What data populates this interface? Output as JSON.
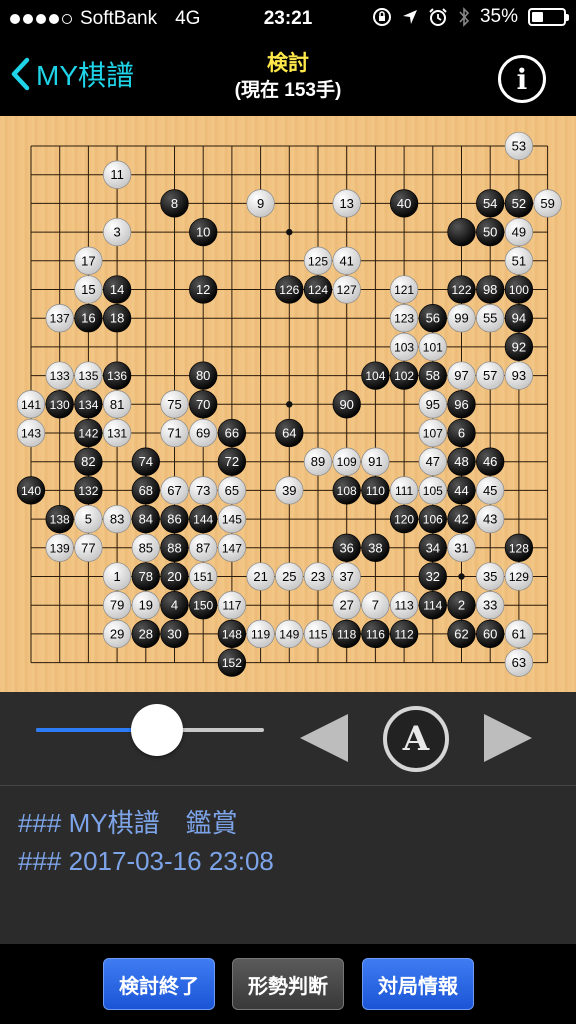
{
  "status": {
    "carrier": "SoftBank",
    "network": "4G",
    "time": "23:21",
    "battery_text": "35%",
    "battery_level": 0.35,
    "signal_bars": 4,
    "icons": [
      "rotation-lock-icon",
      "location-icon",
      "alarm-icon",
      "bluetooth-icon",
      "battery-icon"
    ]
  },
  "nav": {
    "back_label": "MY棋譜",
    "title": "検討",
    "subtitle": "(現在 153手)",
    "info_label": "i"
  },
  "colors": {
    "accent_cyan": "#1fd3e8",
    "title_yellow": "#ffe94a",
    "slider_blue": "#2b7cf6",
    "comment_text": "#7da4e8",
    "button_blue": "#2563e0"
  },
  "board": {
    "size": 19,
    "stones": [
      {
        "c": "w",
        "n": "53",
        "x": 17,
        "y": 0
      },
      {
        "c": "w",
        "n": "11",
        "x": 3,
        "y": 1
      },
      {
        "c": "b",
        "n": "8",
        "x": 5,
        "y": 2
      },
      {
        "c": "w",
        "n": "9",
        "x": 8,
        "y": 2
      },
      {
        "c": "w",
        "n": "13",
        "x": 11,
        "y": 2
      },
      {
        "c": "b",
        "n": "40",
        "x": 13,
        "y": 2
      },
      {
        "c": "b",
        "n": "54",
        "x": 16,
        "y": 2
      },
      {
        "c": "b",
        "n": "52",
        "x": 17,
        "y": 2
      },
      {
        "c": "w",
        "n": "59",
        "x": 18,
        "y": 2
      },
      {
        "c": "w",
        "n": "3",
        "x": 3,
        "y": 3
      },
      {
        "c": "b",
        "n": "10",
        "x": 6,
        "y": 3
      },
      {
        "c": "b",
        "n": "",
        "x": 15,
        "y": 3
      },
      {
        "c": "b",
        "n": "50",
        "x": 16,
        "y": 3
      },
      {
        "c": "w",
        "n": "49",
        "x": 17,
        "y": 3
      },
      {
        "c": "w",
        "n": "17",
        "x": 2,
        "y": 4
      },
      {
        "c": "w",
        "n": "125",
        "x": 10,
        "y": 4
      },
      {
        "c": "w",
        "n": "41",
        "x": 11,
        "y": 4
      },
      {
        "c": "w",
        "n": "51",
        "x": 17,
        "y": 4
      },
      {
        "c": "w",
        "n": "15",
        "x": 2,
        "y": 5
      },
      {
        "c": "b",
        "n": "14",
        "x": 3,
        "y": 5
      },
      {
        "c": "b",
        "n": "12",
        "x": 6,
        "y": 5
      },
      {
        "c": "b",
        "n": "126",
        "x": 9,
        "y": 5
      },
      {
        "c": "b",
        "n": "124",
        "x": 10,
        "y": 5
      },
      {
        "c": "w",
        "n": "127",
        "x": 11,
        "y": 5
      },
      {
        "c": "w",
        "n": "121",
        "x": 13,
        "y": 5
      },
      {
        "c": "b",
        "n": "122",
        "x": 15,
        "y": 5
      },
      {
        "c": "b",
        "n": "98",
        "x": 16,
        "y": 5
      },
      {
        "c": "b",
        "n": "100",
        "x": 17,
        "y": 5
      },
      {
        "c": "w",
        "n": "137",
        "x": 1,
        "y": 6
      },
      {
        "c": "b",
        "n": "16",
        "x": 2,
        "y": 6
      },
      {
        "c": "b",
        "n": "18",
        "x": 3,
        "y": 6
      },
      {
        "c": "w",
        "n": "123",
        "x": 13,
        "y": 6
      },
      {
        "c": "b",
        "n": "56",
        "x": 14,
        "y": 6
      },
      {
        "c": "w",
        "n": "99",
        "x": 15,
        "y": 6
      },
      {
        "c": "w",
        "n": "55",
        "x": 16,
        "y": 6
      },
      {
        "c": "b",
        "n": "94",
        "x": 17,
        "y": 6
      },
      {
        "c": "w",
        "n": "103",
        "x": 13,
        "y": 7
      },
      {
        "c": "w",
        "n": "101",
        "x": 14,
        "y": 7
      },
      {
        "c": "b",
        "n": "92",
        "x": 17,
        "y": 7
      },
      {
        "c": "w",
        "n": "133",
        "x": 1,
        "y": 8
      },
      {
        "c": "w",
        "n": "135",
        "x": 2,
        "y": 8
      },
      {
        "c": "b",
        "n": "136",
        "x": 3,
        "y": 8
      },
      {
        "c": "b",
        "n": "80",
        "x": 6,
        "y": 8
      },
      {
        "c": "b",
        "n": "104",
        "x": 12,
        "y": 8
      },
      {
        "c": "b",
        "n": "102",
        "x": 13,
        "y": 8
      },
      {
        "c": "b",
        "n": "58",
        "x": 14,
        "y": 8
      },
      {
        "c": "w",
        "n": "97",
        "x": 15,
        "y": 8
      },
      {
        "c": "w",
        "n": "57",
        "x": 16,
        "y": 8
      },
      {
        "c": "w",
        "n": "93",
        "x": 17,
        "y": 8
      },
      {
        "c": "w",
        "n": "141",
        "x": 0,
        "y": 9
      },
      {
        "c": "b",
        "n": "130",
        "x": 1,
        "y": 9
      },
      {
        "c": "b",
        "n": "134",
        "x": 2,
        "y": 9
      },
      {
        "c": "w",
        "n": "81",
        "x": 3,
        "y": 9
      },
      {
        "c": "w",
        "n": "75",
        "x": 5,
        "y": 9
      },
      {
        "c": "b",
        "n": "70",
        "x": 6,
        "y": 9
      },
      {
        "c": "b",
        "n": "90",
        "x": 11,
        "y": 9
      },
      {
        "c": "w",
        "n": "95",
        "x": 14,
        "y": 9
      },
      {
        "c": "b",
        "n": "96",
        "x": 15,
        "y": 9
      },
      {
        "c": "w",
        "n": "143",
        "x": 0,
        "y": 10
      },
      {
        "c": "b",
        "n": "142",
        "x": 2,
        "y": 10
      },
      {
        "c": "w",
        "n": "131",
        "x": 3,
        "y": 10
      },
      {
        "c": "w",
        "n": "71",
        "x": 5,
        "y": 10
      },
      {
        "c": "w",
        "n": "69",
        "x": 6,
        "y": 10
      },
      {
        "c": "b",
        "n": "66",
        "x": 7,
        "y": 10
      },
      {
        "c": "b",
        "n": "64",
        "x": 9,
        "y": 10
      },
      {
        "c": "w",
        "n": "107",
        "x": 14,
        "y": 10
      },
      {
        "c": "b",
        "n": "6",
        "x": 15,
        "y": 10
      },
      {
        "c": "b",
        "n": "82",
        "x": 2,
        "y": 11
      },
      {
        "c": "b",
        "n": "74",
        "x": 4,
        "y": 11
      },
      {
        "c": "b",
        "n": "72",
        "x": 7,
        "y": 11
      },
      {
        "c": "w",
        "n": "89",
        "x": 10,
        "y": 11
      },
      {
        "c": "w",
        "n": "109",
        "x": 11,
        "y": 11
      },
      {
        "c": "w",
        "n": "91",
        "x": 12,
        "y": 11
      },
      {
        "c": "w",
        "n": "47",
        "x": 14,
        "y": 11
      },
      {
        "c": "b",
        "n": "48",
        "x": 15,
        "y": 11
      },
      {
        "c": "b",
        "n": "46",
        "x": 16,
        "y": 11
      },
      {
        "c": "b",
        "n": "140",
        "x": 0,
        "y": 12
      },
      {
        "c": "b",
        "n": "132",
        "x": 2,
        "y": 12
      },
      {
        "c": "b",
        "n": "68",
        "x": 4,
        "y": 12
      },
      {
        "c": "w",
        "n": "67",
        "x": 5,
        "y": 12
      },
      {
        "c": "w",
        "n": "73",
        "x": 6,
        "y": 12
      },
      {
        "c": "w",
        "n": "65",
        "x": 7,
        "y": 12
      },
      {
        "c": "w",
        "n": "39",
        "x": 9,
        "y": 12
      },
      {
        "c": "b",
        "n": "108",
        "x": 11,
        "y": 12
      },
      {
        "c": "b",
        "n": "110",
        "x": 12,
        "y": 12
      },
      {
        "c": "w",
        "n": "111",
        "x": 13,
        "y": 12
      },
      {
        "c": "w",
        "n": "105",
        "x": 14,
        "y": 12
      },
      {
        "c": "b",
        "n": "44",
        "x": 15,
        "y": 12
      },
      {
        "c": "w",
        "n": "45",
        "x": 16,
        "y": 12
      },
      {
        "c": "b",
        "n": "138",
        "x": 1,
        "y": 13
      },
      {
        "c": "w",
        "n": "5",
        "x": 2,
        "y": 13
      },
      {
        "c": "w",
        "n": "83",
        "x": 3,
        "y": 13
      },
      {
        "c": "b",
        "n": "84",
        "x": 4,
        "y": 13
      },
      {
        "c": "b",
        "n": "86",
        "x": 5,
        "y": 13
      },
      {
        "c": "b",
        "n": "144",
        "x": 6,
        "y": 13
      },
      {
        "c": "w",
        "n": "145",
        "x": 7,
        "y": 13
      },
      {
        "c": "b",
        "n": "120",
        "x": 13,
        "y": 13
      },
      {
        "c": "b",
        "n": "106",
        "x": 14,
        "y": 13
      },
      {
        "c": "b",
        "n": "42",
        "x": 15,
        "y": 13
      },
      {
        "c": "w",
        "n": "43",
        "x": 16,
        "y": 13
      },
      {
        "c": "w",
        "n": "139",
        "x": 1,
        "y": 14
      },
      {
        "c": "w",
        "n": "77",
        "x": 2,
        "y": 14
      },
      {
        "c": "w",
        "n": "85",
        "x": 4,
        "y": 14
      },
      {
        "c": "b",
        "n": "88",
        "x": 5,
        "y": 14
      },
      {
        "c": "w",
        "n": "87",
        "x": 6,
        "y": 14
      },
      {
        "c": "w",
        "n": "147",
        "x": 7,
        "y": 14
      },
      {
        "c": "b",
        "n": "36",
        "x": 11,
        "y": 14
      },
      {
        "c": "b",
        "n": "38",
        "x": 12,
        "y": 14
      },
      {
        "c": "b",
        "n": "34",
        "x": 14,
        "y": 14
      },
      {
        "c": "w",
        "n": "31",
        "x": 15,
        "y": 14
      },
      {
        "c": "b",
        "n": "128",
        "x": 17,
        "y": 14
      },
      {
        "c": "w",
        "n": "1",
        "x": 3,
        "y": 15
      },
      {
        "c": "b",
        "n": "78",
        "x": 4,
        "y": 15
      },
      {
        "c": "b",
        "n": "20",
        "x": 5,
        "y": 15
      },
      {
        "c": "w",
        "n": "151",
        "x": 6,
        "y": 15
      },
      {
        "c": "w",
        "n": "21",
        "x": 8,
        "y": 15
      },
      {
        "c": "w",
        "n": "25",
        "x": 9,
        "y": 15
      },
      {
        "c": "w",
        "n": "23",
        "x": 10,
        "y": 15
      },
      {
        "c": "w",
        "n": "37",
        "x": 11,
        "y": 15
      },
      {
        "c": "b",
        "n": "32",
        "x": 14,
        "y": 15
      },
      {
        "c": "w",
        "n": "35",
        "x": 16,
        "y": 15
      },
      {
        "c": "w",
        "n": "129",
        "x": 17,
        "y": 15
      },
      {
        "c": "w",
        "n": "79",
        "x": 3,
        "y": 16
      },
      {
        "c": "w",
        "n": "19",
        "x": 4,
        "y": 16
      },
      {
        "c": "b",
        "n": "4",
        "x": 5,
        "y": 16
      },
      {
        "c": "b",
        "n": "150",
        "x": 6,
        "y": 16
      },
      {
        "c": "w",
        "n": "117",
        "x": 7,
        "y": 16
      },
      {
        "c": "w",
        "n": "27",
        "x": 11,
        "y": 16
      },
      {
        "c": "w",
        "n": "7",
        "x": 12,
        "y": 16
      },
      {
        "c": "w",
        "n": "113",
        "x": 13,
        "y": 16
      },
      {
        "c": "b",
        "n": "114",
        "x": 14,
        "y": 16
      },
      {
        "c": "b",
        "n": "2",
        "x": 15,
        "y": 16
      },
      {
        "c": "w",
        "n": "33",
        "x": 16,
        "y": 16
      },
      {
        "c": "w",
        "n": "29",
        "x": 3,
        "y": 17
      },
      {
        "c": "b",
        "n": "28",
        "x": 4,
        "y": 17
      },
      {
        "c": "b",
        "n": "30",
        "x": 5,
        "y": 17
      },
      {
        "c": "b",
        "n": "148",
        "x": 7,
        "y": 17
      },
      {
        "c": "w",
        "n": "119",
        "x": 8,
        "y": 17
      },
      {
        "c": "w",
        "n": "149",
        "x": 9,
        "y": 17
      },
      {
        "c": "w",
        "n": "115",
        "x": 10,
        "y": 17
      },
      {
        "c": "b",
        "n": "118",
        "x": 11,
        "y": 17
      },
      {
        "c": "b",
        "n": "116",
        "x": 12,
        "y": 17
      },
      {
        "c": "b",
        "n": "112",
        "x": 13,
        "y": 17
      },
      {
        "c": "b",
        "n": "62",
        "x": 15,
        "y": 17
      },
      {
        "c": "b",
        "n": "60",
        "x": 16,
        "y": 17
      },
      {
        "c": "w",
        "n": "61",
        "x": 17,
        "y": 17
      },
      {
        "c": "b",
        "n": "152",
        "x": 7,
        "y": 18
      },
      {
        "c": "w",
        "n": "63",
        "x": 17,
        "y": 18
      }
    ]
  },
  "controls": {
    "slider_value": 0.53,
    "prev_icon": "triangle-left-icon",
    "auto_label": "A",
    "next_icon": "triangle-right-icon"
  },
  "comment": {
    "line1": "### MY棋譜　鑑賞",
    "line2": "### 2017-03-16 23:08"
  },
  "buttons": {
    "end_review": "検討終了",
    "evaluate": "形勢判断",
    "game_info": "対局情報"
  }
}
